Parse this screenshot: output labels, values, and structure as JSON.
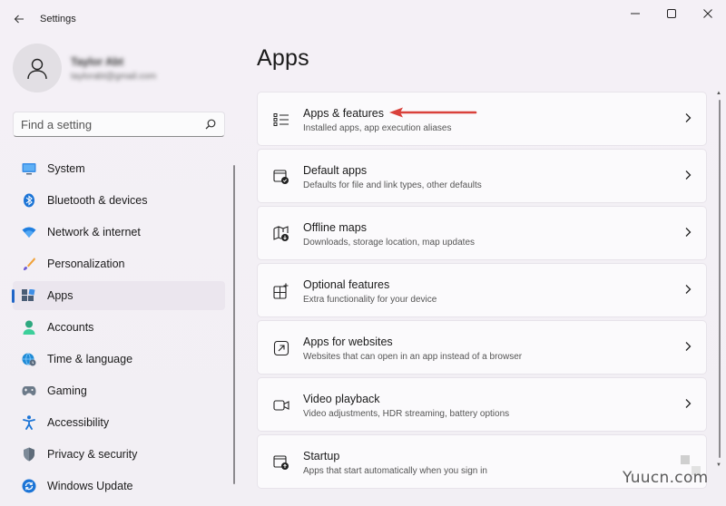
{
  "window": {
    "title": "Settings",
    "controls": [
      "minimize",
      "maximize",
      "close"
    ]
  },
  "profile": {
    "name": "Taylor Abt",
    "email": "taylorabt@gmail.com"
  },
  "search": {
    "placeholder": "Find a setting",
    "value": ""
  },
  "sidebar": {
    "items": [
      {
        "label": "System",
        "icon": "monitor-icon"
      },
      {
        "label": "Bluetooth & devices",
        "icon": "bluetooth-icon"
      },
      {
        "label": "Network & internet",
        "icon": "wifi-icon"
      },
      {
        "label": "Personalization",
        "icon": "brush-icon"
      },
      {
        "label": "Apps",
        "icon": "apps-icon",
        "selected": true
      },
      {
        "label": "Accounts",
        "icon": "person-icon"
      },
      {
        "label": "Time & language",
        "icon": "globe-clock-icon"
      },
      {
        "label": "Gaming",
        "icon": "gamepad-icon"
      },
      {
        "label": "Accessibility",
        "icon": "accessibility-icon"
      },
      {
        "label": "Privacy & security",
        "icon": "shield-icon"
      },
      {
        "label": "Windows Update",
        "icon": "update-icon"
      }
    ]
  },
  "main": {
    "title": "Apps",
    "cards": [
      {
        "title": "Apps & features",
        "subtitle": "Installed apps, app execution aliases",
        "icon": "apps-list-icon"
      },
      {
        "title": "Default apps",
        "subtitle": "Defaults for file and link types, other defaults",
        "icon": "default-apps-icon"
      },
      {
        "title": "Offline maps",
        "subtitle": "Downloads, storage location, map updates",
        "icon": "map-download-icon"
      },
      {
        "title": "Optional features",
        "subtitle": "Extra functionality for your device",
        "icon": "add-grid-icon"
      },
      {
        "title": "Apps for websites",
        "subtitle": "Websites that can open in an app instead of a browser",
        "icon": "open-external-icon"
      },
      {
        "title": "Video playback",
        "subtitle": "Video adjustments, HDR streaming, battery options",
        "icon": "video-icon"
      },
      {
        "title": "Startup",
        "subtitle": "Apps that start automatically when you sign in",
        "icon": "startup-icon"
      }
    ]
  },
  "annotation": {
    "color": "#d9413b"
  },
  "watermark": {
    "text": "Yuucn.com"
  },
  "colors": {
    "accent": "#2066c7",
    "background": "#f3eff5",
    "card": "#fbfafc"
  }
}
